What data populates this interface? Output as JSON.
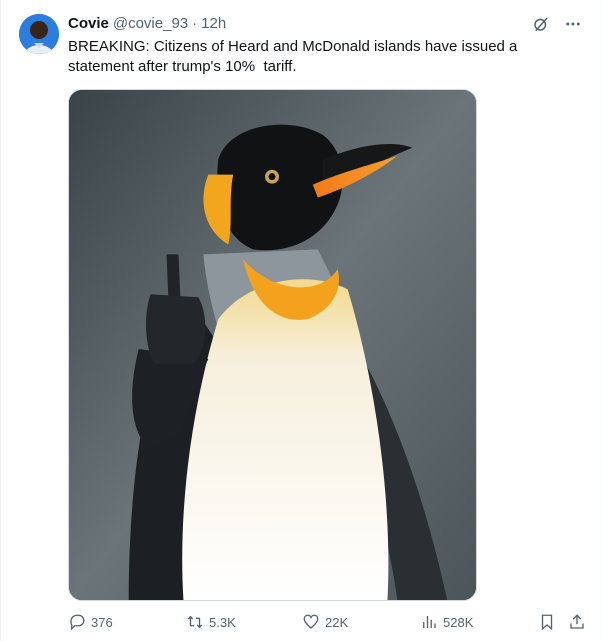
{
  "tweet": {
    "author_name": "Covie",
    "handle": "@covie_93",
    "separator": "·",
    "time": "12h",
    "text": "BREAKING: Citizens of Heard and McDonald islands have issued a statement after trump's 10%  tariff.",
    "media": {
      "subject": "penguin-photo"
    },
    "stats": {
      "replies": "376",
      "reposts": "5.3K",
      "likes": "22K",
      "views": "528K"
    }
  },
  "icons": {
    "grok": "grok-icon",
    "more": "more-icon",
    "reply": "reply-icon",
    "retweet": "retweet-icon",
    "like": "heart-icon",
    "views": "views-icon",
    "bookmark": "bookmark-icon",
    "share": "share-icon"
  },
  "colors": {
    "text": "#0f1419",
    "muted": "#536471",
    "border": "#cfd9de"
  }
}
